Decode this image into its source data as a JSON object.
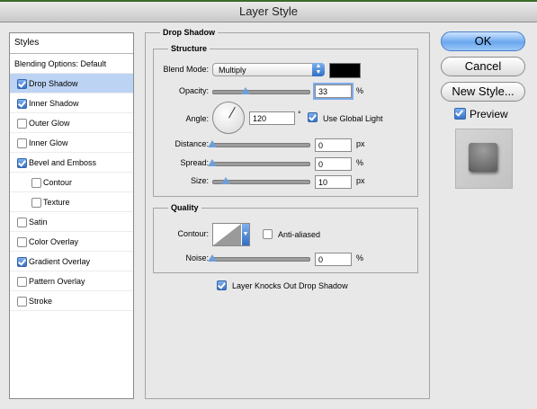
{
  "window": {
    "title": "Layer Style"
  },
  "styles_panel": {
    "header": "Styles",
    "items": [
      {
        "label": "Blending Options: Default",
        "checkbox": false,
        "checked": false,
        "indent": false,
        "selected": false
      },
      {
        "label": "Drop Shadow",
        "checkbox": true,
        "checked": true,
        "indent": false,
        "selected": true
      },
      {
        "label": "Inner Shadow",
        "checkbox": true,
        "checked": true,
        "indent": false,
        "selected": false
      },
      {
        "label": "Outer Glow",
        "checkbox": true,
        "checked": false,
        "indent": false,
        "selected": false
      },
      {
        "label": "Inner Glow",
        "checkbox": true,
        "checked": false,
        "indent": false,
        "selected": false
      },
      {
        "label": "Bevel and Emboss",
        "checkbox": true,
        "checked": true,
        "indent": false,
        "selected": false
      },
      {
        "label": "Contour",
        "checkbox": true,
        "checked": false,
        "indent": true,
        "selected": false
      },
      {
        "label": "Texture",
        "checkbox": true,
        "checked": false,
        "indent": true,
        "selected": false
      },
      {
        "label": "Satin",
        "checkbox": true,
        "checked": false,
        "indent": false,
        "selected": false
      },
      {
        "label": "Color Overlay",
        "checkbox": true,
        "checked": false,
        "indent": false,
        "selected": false
      },
      {
        "label": "Gradient Overlay",
        "checkbox": true,
        "checked": true,
        "indent": false,
        "selected": false
      },
      {
        "label": "Pattern Overlay",
        "checkbox": true,
        "checked": false,
        "indent": false,
        "selected": false
      },
      {
        "label": "Stroke",
        "checkbox": true,
        "checked": false,
        "indent": false,
        "selected": false
      }
    ]
  },
  "drop_shadow": {
    "title": "Drop Shadow",
    "structure": {
      "title": "Structure",
      "blend_mode_label": "Blend Mode:",
      "blend_mode_value": "Multiply",
      "shadow_color": "#000000",
      "opacity_label": "Opacity:",
      "opacity_value": "33",
      "opacity_unit": "%",
      "angle_label": "Angle:",
      "angle_value": "120",
      "angle_unit": "°",
      "use_global_light_label": "Use Global Light",
      "use_global_light_checked": true,
      "distance_label": "Distance:",
      "distance_value": "0",
      "distance_unit": "px",
      "spread_label": "Spread:",
      "spread_value": "0",
      "spread_unit": "%",
      "size_label": "Size:",
      "size_value": "10",
      "size_unit": "px"
    },
    "quality": {
      "title": "Quality",
      "contour_label": "Contour:",
      "anti_aliased_label": "Anti-aliased",
      "anti_aliased_checked": false,
      "noise_label": "Noise:",
      "noise_value": "0",
      "noise_unit": "%"
    },
    "layer_knocks_out_label": "Layer Knocks Out Drop Shadow",
    "layer_knocks_out_checked": true
  },
  "buttons": {
    "ok": "OK",
    "cancel": "Cancel",
    "new_style": "New Style..."
  },
  "preview": {
    "label": "Preview",
    "checked": true
  },
  "colors": {
    "selection": "#bcd3f4",
    "accent_blue": "#3873c8",
    "panel_bg": "#e8e8e8"
  }
}
